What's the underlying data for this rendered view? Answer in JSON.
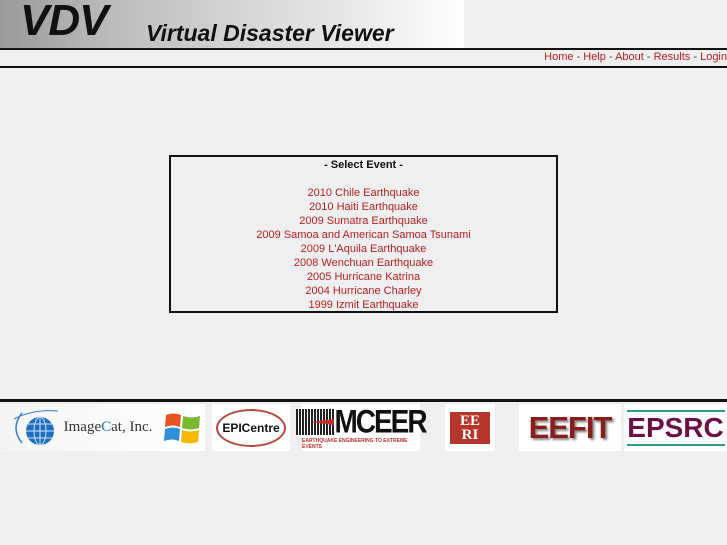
{
  "header": {
    "logo_text": "VDV",
    "title": "Virtual Disaster Viewer"
  },
  "nav": {
    "separator": " - ",
    "links": [
      "Home",
      "Help",
      "About",
      "Results",
      "Login"
    ]
  },
  "event_selector": {
    "title": "- Select Event -",
    "events": [
      "2010 Chile Earthquake",
      "2010 Haiti Earthquake",
      "2009 Sumatra Earthquake",
      "2009 Samoa and American Samoa Tsunami",
      "2009 L'Aquila Earthquake",
      "2008 Wenchuan Earthquake",
      "2005 Hurricane Katrina",
      "2004 Hurricane Charley",
      "1999 Izmit Earthquake"
    ]
  },
  "sponsors": {
    "imagecat_pre": "Image",
    "imagecat_c": "C",
    "imagecat_post": "at, Inc.",
    "epicentre": "EPICentre",
    "mceer": "MCEER",
    "mceer_tagline": "EARTHQUAKE ENGINEERING TO EXTREME EVENTS",
    "eeri_top": "EE",
    "eeri_bottom": "RI",
    "eefit": "EEFIT",
    "epsrc": "EPSRC"
  },
  "colors": {
    "link": "#b22222",
    "background": "#efefef"
  }
}
